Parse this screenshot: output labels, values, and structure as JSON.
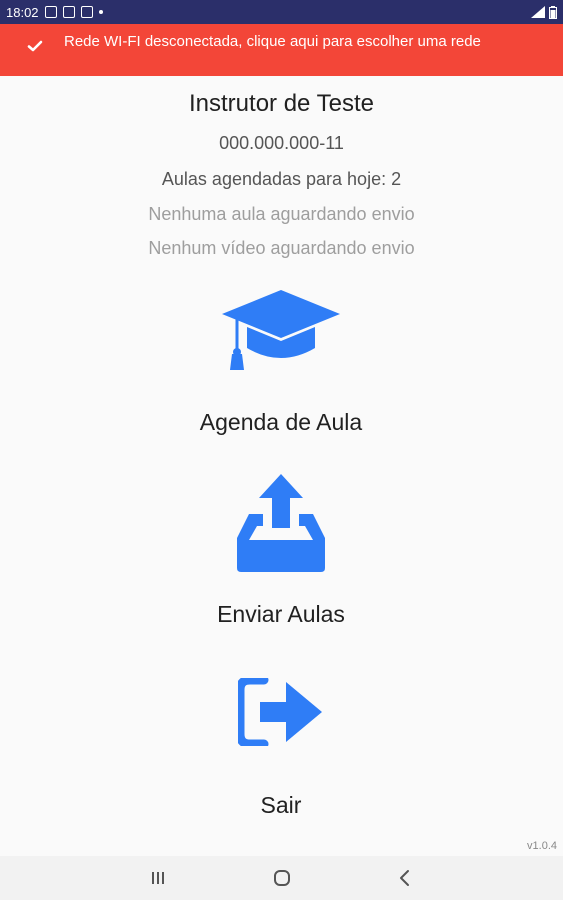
{
  "status": {
    "time": "18:02"
  },
  "banner": {
    "text": "Rede WI-FI desconectada, clique aqui para escolher uma rede"
  },
  "user": {
    "name": "Instrutor de Teste",
    "id": "000.000.000-11",
    "classes_today": "Aulas agendadas para hoje: 2",
    "pending_classes": "Nenhuma aula aguardando envio",
    "pending_videos": "Nenhum vídeo aguardando envio"
  },
  "menu": {
    "schedule_label": "Agenda de Aula",
    "send_label": "Enviar Aulas",
    "exit_label": "Sair"
  },
  "version": "v1.0.4",
  "colors": {
    "accent": "#2f7df6",
    "banner": "#f34638",
    "status_bar": "#2b2f6a"
  },
  "icons": {
    "schedule": "graduation-cap-icon",
    "send": "upload-tray-icon",
    "exit": "sign-out-icon"
  }
}
